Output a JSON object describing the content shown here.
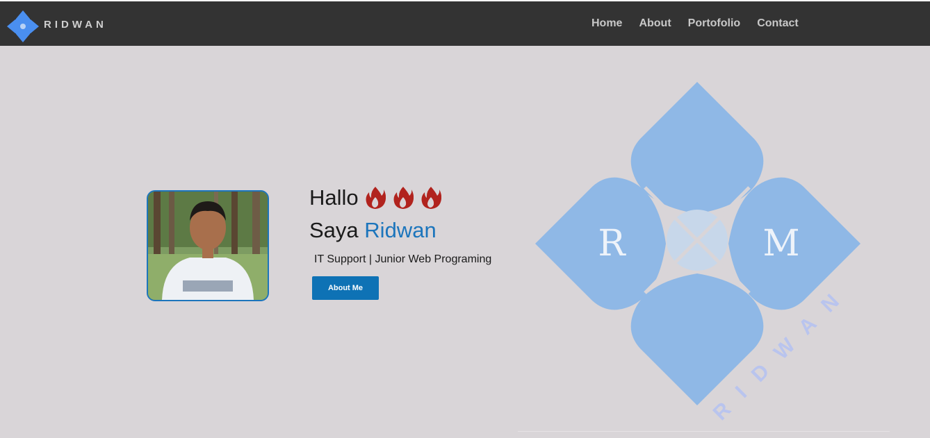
{
  "brand": {
    "name": "RIDWAN"
  },
  "nav": {
    "items": [
      "Home",
      "About",
      "Portofolio",
      "Contact"
    ]
  },
  "hero": {
    "greeting": "Hallo",
    "intro_prefix": "Saya",
    "intro_name": "Ridwan",
    "role": "IT Support | Junior Web Programing",
    "button_label": "About Me"
  },
  "big_logo": {
    "letter_left": "R",
    "letter_right": "M",
    "word": "RIDWAN"
  },
  "icons": [
    "logo-icon",
    "fire-icon",
    "profile-photo"
  ],
  "colors": {
    "topbar": "#333333",
    "background": "#d9d5d8",
    "accent": "#1c75bc",
    "button": "#0e72b5",
    "logo_petal": "#8fb8e6",
    "logo_small": "#4a8ff0",
    "fire": "#b1231e"
  }
}
